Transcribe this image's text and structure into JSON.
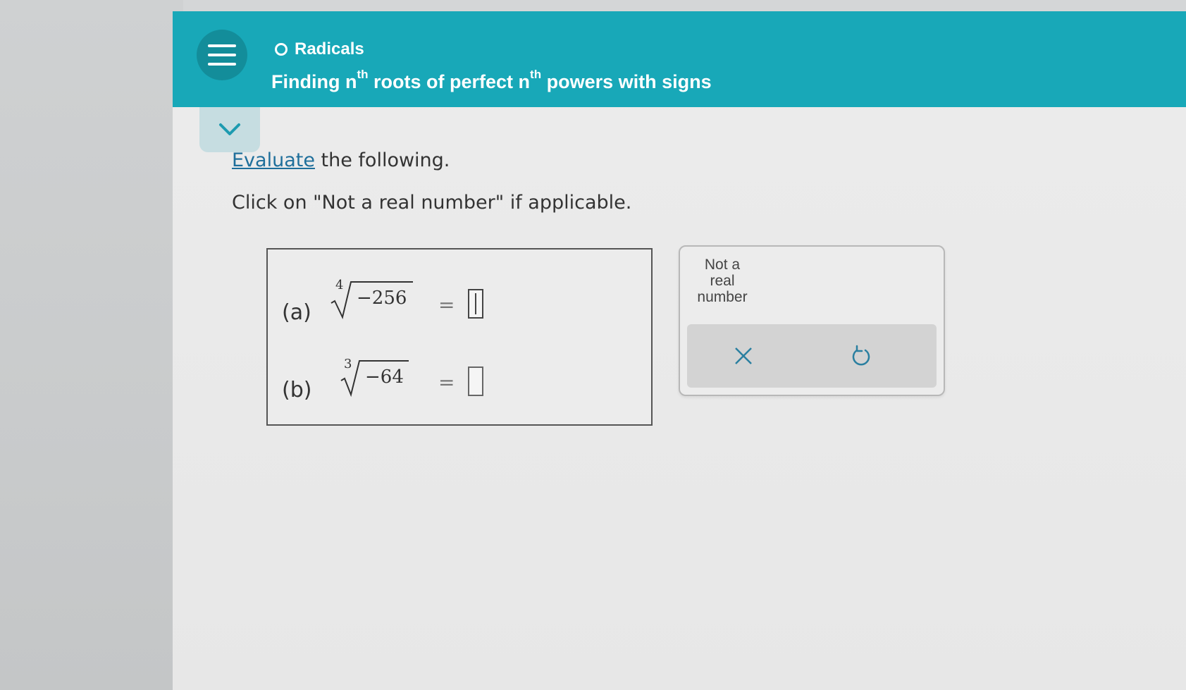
{
  "header": {
    "topic": "Radicals",
    "title_part1": "Finding n",
    "title_sup1": "th",
    "title_part2": " roots of perfect n",
    "title_sup2": "th",
    "title_part3": " powers with signs",
    "background_color": "#18a8b8"
  },
  "question": {
    "link_word": "Evaluate",
    "rest": " the following.",
    "instruction": "Click on \"Not a real number\" if applicable."
  },
  "problems": [
    {
      "label": "(a)",
      "index": "4",
      "radicand": "−256",
      "equals": "=",
      "answer": ""
    },
    {
      "label": "(b)",
      "index": "3",
      "radicand": "−64",
      "equals": "=",
      "answer": ""
    }
  ],
  "keypad": {
    "not_real_line1": "Not a",
    "not_real_line2": "real",
    "not_real_line3": "number",
    "clear_icon": "close-icon",
    "undo_icon": "undo-icon"
  },
  "icons": {
    "menu": "hamburger-menu-icon",
    "collapse": "chevron-down-icon",
    "topic": "circle-outline-icon"
  }
}
